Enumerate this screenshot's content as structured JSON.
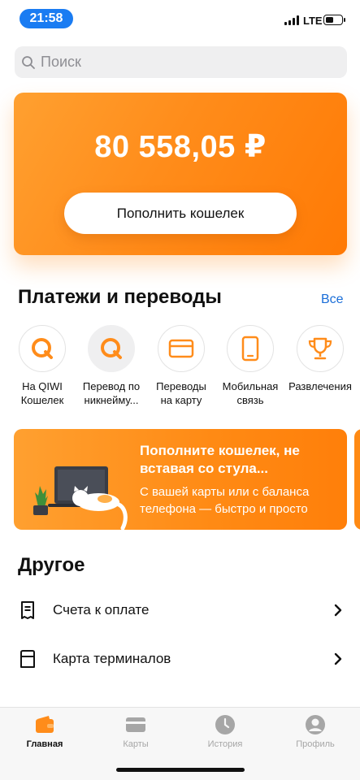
{
  "status_bar": {
    "time": "21:58",
    "network": "LTE",
    "battery_level": 0.55
  },
  "search": {
    "placeholder": "Поиск"
  },
  "balance": {
    "amount": "80 558,05 ₽",
    "topup_label": "Пополнить кошелек"
  },
  "payments": {
    "title": "Платежи и переводы",
    "all_label": "Все",
    "items": [
      {
        "label": "На QIWI Кошелек",
        "icon": "qiwi-logo-icon"
      },
      {
        "label": "Перевод по никнейму...",
        "icon": "qiwi-logo-icon"
      },
      {
        "label": "Переводы на карту",
        "icon": "card-icon"
      },
      {
        "label": "Мобильная связь",
        "icon": "phone-icon"
      },
      {
        "label": "Развлечения",
        "icon": "trophy-icon"
      }
    ]
  },
  "promo": {
    "title": "Пополните кошелек, не вставая со стула...",
    "text": "С вашей карты или с баланса телефона — быстро и просто"
  },
  "other": {
    "title": "Другое",
    "items": [
      {
        "label": "Счета к оплате",
        "icon": "receipt-icon"
      },
      {
        "label": "Карта терминалов",
        "icon": "terminal-icon"
      }
    ]
  },
  "tabbar": {
    "items": [
      {
        "label": "Главная",
        "icon": "wallet-icon",
        "active": true
      },
      {
        "label": "Карты",
        "icon": "cards-icon",
        "active": false
      },
      {
        "label": "История",
        "icon": "clock-icon",
        "active": false
      },
      {
        "label": "Профиль",
        "icon": "profile-icon",
        "active": false
      }
    ]
  },
  "colors": {
    "accent": "#ff8c1a",
    "link": "#1a6ed8",
    "time_pill": "#1a7cf2"
  }
}
